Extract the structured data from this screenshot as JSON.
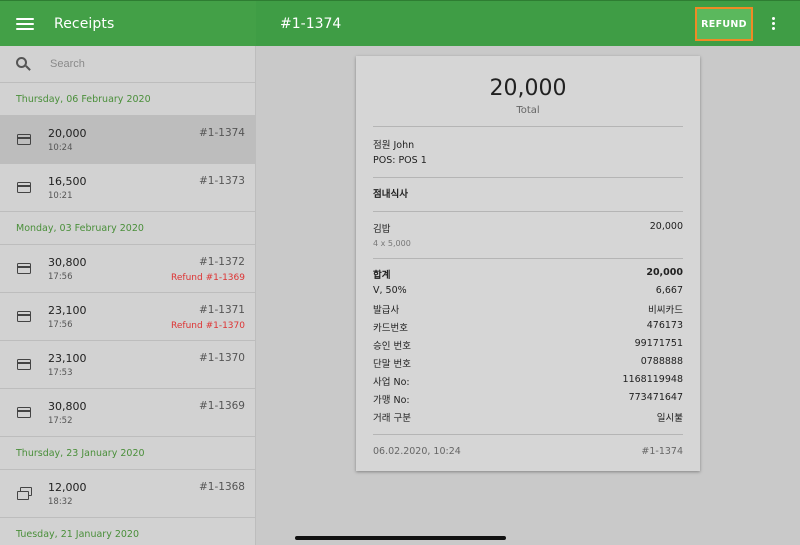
{
  "app": {
    "title": "Receipts"
  },
  "header": {
    "receipt_number": "#1-1374",
    "refund_label": "REFUND"
  },
  "search": {
    "placeholder": "Search",
    "value": ""
  },
  "groups": [
    {
      "date": "Thursday, 06 February 2020",
      "items": [
        {
          "amount": "20,000",
          "time": "10:24",
          "number": "#1-1374",
          "refund": "",
          "icon": "credit-card-icon",
          "selected": true
        },
        {
          "amount": "16,500",
          "time": "10:21",
          "number": "#1-1373",
          "refund": "",
          "icon": "credit-card-icon"
        }
      ]
    },
    {
      "date": "Monday, 03 February 2020",
      "items": [
        {
          "amount": "30,800",
          "time": "17:56",
          "number": "#1-1372",
          "refund": "Refund #1-1369",
          "icon": "credit-card-icon"
        },
        {
          "amount": "23,100",
          "time": "17:56",
          "number": "#1-1371",
          "refund": "Refund #1-1370",
          "icon": "credit-card-icon"
        },
        {
          "amount": "23,100",
          "time": "17:53",
          "number": "#1-1370",
          "refund": "",
          "icon": "credit-card-icon"
        },
        {
          "amount": "30,800",
          "time": "17:52",
          "number": "#1-1369",
          "refund": "",
          "icon": "credit-card-icon"
        }
      ]
    },
    {
      "date": "Thursday, 23 January 2020",
      "items": [
        {
          "amount": "12,000",
          "time": "18:32",
          "number": "#1-1368",
          "refund": "",
          "icon": "multiple-payment-icon"
        }
      ]
    },
    {
      "date": "Tuesday, 21 January 2020",
      "items": []
    }
  ],
  "receipt": {
    "total": "20,000",
    "total_label": "Total",
    "employee": "점원 John",
    "pos": "POS: POS 1",
    "dining_option": "점내식사",
    "item": {
      "name": "김밥",
      "price": "20,000",
      "qty_detail": "4 x 5,000"
    },
    "sum_label": "합계",
    "sum_value": "20,000",
    "vat_label": "V,  50%",
    "vat_value": "6,667",
    "card_details": [
      {
        "label": "발급사",
        "value": "비씨카드"
      },
      {
        "label": "카드번호",
        "value": "476173"
      },
      {
        "label": "승인 번호",
        "value": "99171751"
      },
      {
        "label": "단말 번호",
        "value": "0788888"
      },
      {
        "label": "사업 No:",
        "value": "1168119948"
      },
      {
        "label": "가맹 No:",
        "value": "773471647"
      },
      {
        "label": "거래 구분",
        "value": "일시불"
      }
    ],
    "footer_datetime": "06.02.2020, 10:24",
    "footer_number": "#1-1374"
  },
  "colors": {
    "primary": "#43a047",
    "date_header": "#4a8f3a",
    "refund_text": "#d33333",
    "highlight_border": "#ef8a25"
  }
}
